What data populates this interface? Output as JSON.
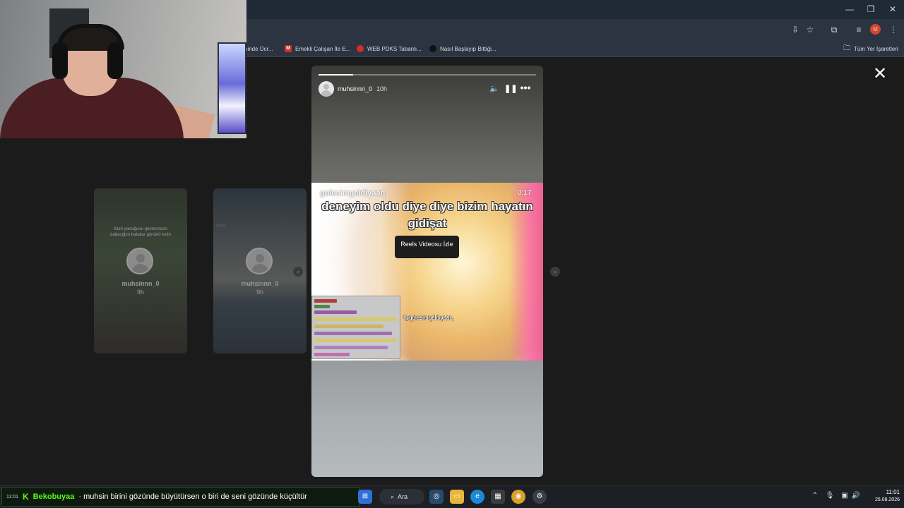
{
  "browser": {
    "window_controls": {
      "minimize": "—",
      "restore": "❐",
      "close": "✕"
    },
    "bookmarks": [
      {
        "label": "ninde Ücr...",
        "icon": ""
      },
      {
        "label": "Emekli Çalışan İle E...",
        "icon": "M"
      },
      {
        "label": "WEB PDKS Tabanlı...",
        "icon": ""
      },
      {
        "label": "Nasıl Başlayıp Bittiği...",
        "icon": ""
      }
    ],
    "all_bookmarks_label": "Tüm Yer İşaretleri",
    "profile_initial": "M"
  },
  "viewer": {
    "close_label": "✕"
  },
  "side_stories": [
    {
      "username": "muhsinnn_0",
      "time": "9h",
      "caption": "Allah yokluğunu göstermesin babacığım babalar gününü kutlu"
    },
    {
      "username": "muhsinnn_0",
      "time": "9h",
      "caption": ""
    }
  ],
  "story": {
    "username": "muhsinnn_0",
    "time": "10h",
    "progress": 0.16,
    "reel": {
      "handle": "gulesimgeldiyaaq",
      "duration": "0:17",
      "caption": "deneyim oldu diye diye bizim hayatın gidişat",
      "button_label": "Reels Videosu İzle",
      "tag": "@gulesimgeldiyaaq"
    }
  },
  "ticker": {
    "time": "11:01",
    "logo": "K",
    "user": "Bekobuyaa",
    "message": "· muhsin birini gözünde büyütürsen o biri de seni gözünde küçültür"
  },
  "taskbar": {
    "search_label": "Ara",
    "clock_time": "11:01",
    "clock_date": "25.08.2026"
  },
  "colors": {
    "kick_green": "#53fc18",
    "chrome_bg": "#1f2a36"
  }
}
